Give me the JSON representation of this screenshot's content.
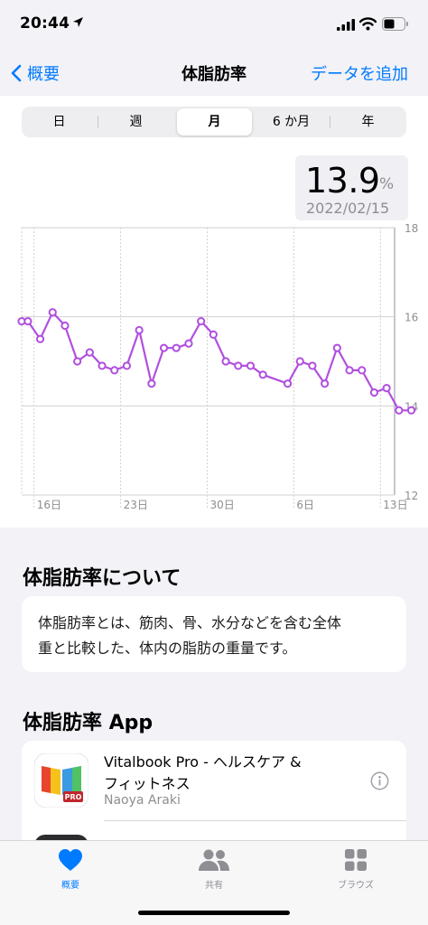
{
  "status_bar": {
    "time": "20:44"
  },
  "nav": {
    "back_label": "概要",
    "title": "体脂肪率",
    "add_label": "データを追加"
  },
  "segments": [
    {
      "label": "日",
      "active": false
    },
    {
      "label": "週",
      "active": false
    },
    {
      "label": "月",
      "active": true
    },
    {
      "label": "6 か月",
      "active": false
    },
    {
      "label": "年",
      "active": false
    }
  ],
  "readout": {
    "value": "13.9",
    "unit": "%",
    "date": "2022/02/15"
  },
  "colors": {
    "accent": "#007aff",
    "series": "#b14fdf",
    "grid": "#d1d1d6"
  },
  "chart_data": {
    "type": "line",
    "ylim": [
      12,
      18
    ],
    "y_ticks": [
      "18",
      "16",
      "14",
      "12"
    ],
    "x_tick_labels": [
      "16日",
      "23日",
      "30日",
      "6日",
      "13日"
    ],
    "x_tick_days": [
      1,
      8,
      15,
      22,
      29
    ],
    "grid": true,
    "series": [
      {
        "x": [
          0,
          0.5,
          1.5,
          2.5,
          3.5,
          4.5,
          5.5,
          6.5,
          7.5,
          8.5,
          9.5,
          10.5,
          11.5,
          12.5,
          13.5,
          14.5,
          15.5,
          16.5,
          17.5,
          18.5,
          19.5,
          21.5,
          22.5,
          23.5,
          24.5,
          25.5,
          26.5,
          27.5,
          28.5,
          29.5,
          30.5,
          31.5
        ],
        "values": [
          15.9,
          15.9,
          15.5,
          16.1,
          15.8,
          15.0,
          15.2,
          14.9,
          14.8,
          14.9,
          15.7,
          14.5,
          15.3,
          15.3,
          15.4,
          15.9,
          15.6,
          15.0,
          14.9,
          14.9,
          14.7,
          14.5,
          15.0,
          14.9,
          14.5,
          15.3,
          14.8,
          14.8,
          14.3,
          14.4,
          13.9,
          13.9
        ]
      }
    ]
  },
  "about": {
    "title": "体脂肪率について",
    "line1": "体脂肪率とは、筋肉、骨、水分などを含む全体",
    "line2": "重と比較した、体内の脂肪の重量です。"
  },
  "apps": {
    "title": "体脂肪率 App",
    "items": [
      {
        "name_line1": "Vitalbook Pro - ヘルスケア &",
        "name_line2": "フィットネス",
        "developer": "Naoya Araki",
        "icon_badge": "PRO"
      }
    ]
  },
  "tabbar": {
    "items": [
      {
        "label": "概要",
        "icon": "heart-icon",
        "active": true
      },
      {
        "label": "共有",
        "icon": "people-icon",
        "active": false
      },
      {
        "label": "ブラウズ",
        "icon": "grid-icon",
        "active": false
      }
    ]
  }
}
